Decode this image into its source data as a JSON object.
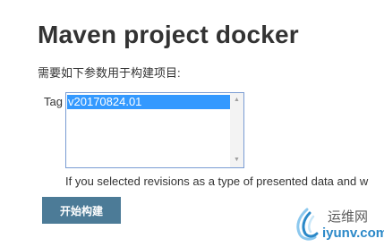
{
  "page": {
    "title": "Maven project docker",
    "description": "需要如下参数用于构建项目:"
  },
  "parameter": {
    "label": "Tag",
    "options": [
      "v20170824.01"
    ],
    "selected": "v20170824.01",
    "help": "If you selected revisions as a type of presented data and w"
  },
  "actions": {
    "build_label": "开始构建"
  },
  "watermark": {
    "cn_text": "运维网",
    "en_text": "iyunv.com"
  },
  "icons": {
    "scroll_up": "scroll-up-arrow-icon",
    "scroll_down": "scroll-down-arrow-icon",
    "watermark_logo": "swirl-logo-icon"
  },
  "colors": {
    "button_bg": "#4c7b97",
    "selection": "#3399ff",
    "listbox_border": "#7a9cd3",
    "watermark_accent": "#2a88c8"
  }
}
